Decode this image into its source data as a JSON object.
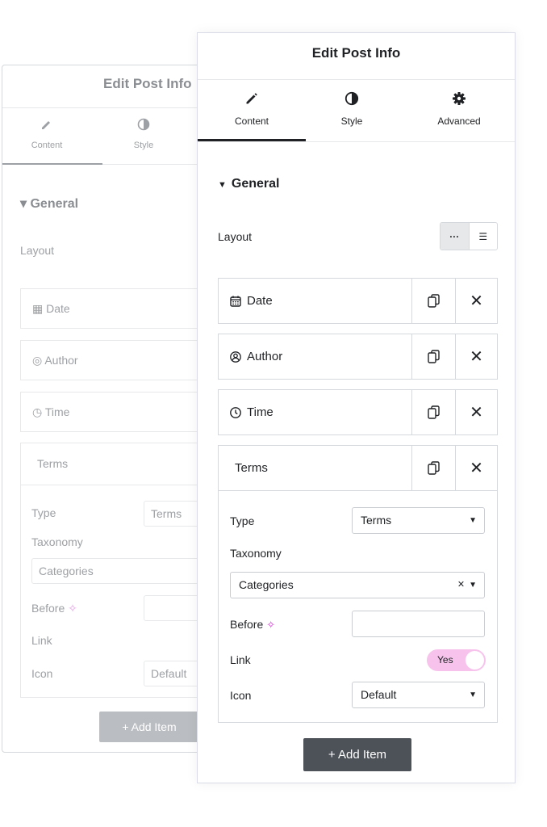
{
  "panel_title": "Edit Post Info",
  "tabs": [
    {
      "label": "Content",
      "icon": "pencil-icon",
      "active": true
    },
    {
      "label": "Style",
      "icon": "half-circle-icon",
      "active": false
    },
    {
      "label": "Advanced",
      "icon": "gear-icon",
      "active": false
    }
  ],
  "section": {
    "title": "General",
    "expanded": true
  },
  "layout": {
    "label": "Layout",
    "options": [
      "···",
      "☰"
    ],
    "selected": "inline"
  },
  "items": [
    {
      "label": "Date",
      "icon": "calendar-icon"
    },
    {
      "label": "Author",
      "icon": "user-circle-icon"
    },
    {
      "label": "Time",
      "icon": "clock-icon"
    },
    {
      "label": "Terms",
      "icon": ""
    }
  ],
  "terms_editor": {
    "type_label": "Type",
    "type_value": "Terms",
    "taxonomy_label": "Taxonomy",
    "taxonomy_value": "Categories",
    "before_label": "Before",
    "before_value": "",
    "link_label": "Link",
    "link_value": "Yes",
    "icon_label": "Icon",
    "icon_value": "Default"
  },
  "add_item_label": "+ Add Item",
  "colors": {
    "ai_accent": "#d63ad6",
    "switch_on": "#f7c3ec",
    "add_button": "#4d5259"
  }
}
